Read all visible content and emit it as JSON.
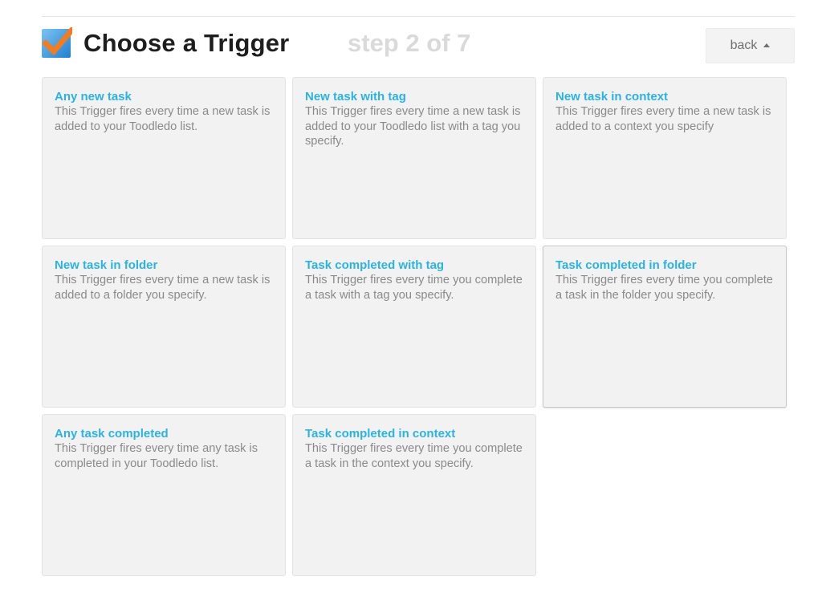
{
  "header": {
    "title": "Choose a Trigger",
    "step": "step 2 of 7",
    "back_label": "back",
    "logo_icon": "toodledo-checkmark-icon"
  },
  "colors": {
    "accent": "#2bb3e6",
    "logo_blue": "#2f8fd8",
    "logo_orange": "#f47c20"
  },
  "triggers": [
    {
      "title": "Any new task",
      "description": "This Trigger fires every time a new task is added to your Toodledo list."
    },
    {
      "title": "New task with tag",
      "description": "This Trigger fires every time a new task is added to your Toodledo list with a tag you specify."
    },
    {
      "title": "New task in context",
      "description": "This Trigger fires every time a new task is added to a context you specify"
    },
    {
      "title": "New task in folder",
      "description": "This Trigger fires every time a new task is added to a folder you specify."
    },
    {
      "title": "Task completed with tag",
      "description": "This Trigger fires every time you complete a task with a tag you specify."
    },
    {
      "title": "Task completed in folder",
      "description": "This Trigger fires every time you complete a task in the folder you specify."
    },
    {
      "title": "Any task completed",
      "description": "This Trigger fires every time any task is completed in your Toodledo list."
    },
    {
      "title": "Task completed in context",
      "description": "This Trigger fires every time you complete a task in the context you specify."
    }
  ]
}
